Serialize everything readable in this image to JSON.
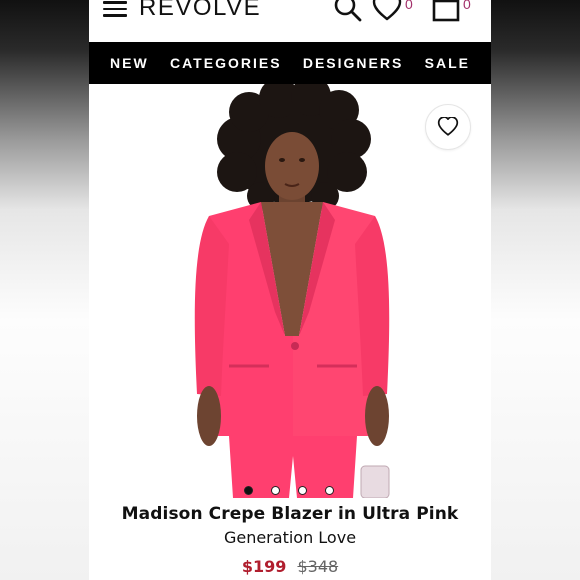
{
  "header": {
    "logo": "REVOLVE",
    "wishlist_count": "0",
    "bag_count": "0"
  },
  "nav": {
    "items": [
      "NEW",
      "CATEGORIES",
      "DESIGNERS",
      "SALE"
    ]
  },
  "product": {
    "name": "Madison Crepe Blazer in Ultra Pink",
    "brand": "Generation Love",
    "sale_price": "$199",
    "original_price": "$348",
    "gallery_dots": 4,
    "active_dot_index": 0
  },
  "colors": {
    "accent_count": "#a3316b",
    "sale_price": "#b01e2e",
    "blazer_pink": "#ff3f6f",
    "nav_background": "#000000"
  },
  "icons": [
    "hamburger-menu-icon",
    "search-icon",
    "heart-icon",
    "shopping-bag-icon",
    "heart-outline-icon"
  ]
}
